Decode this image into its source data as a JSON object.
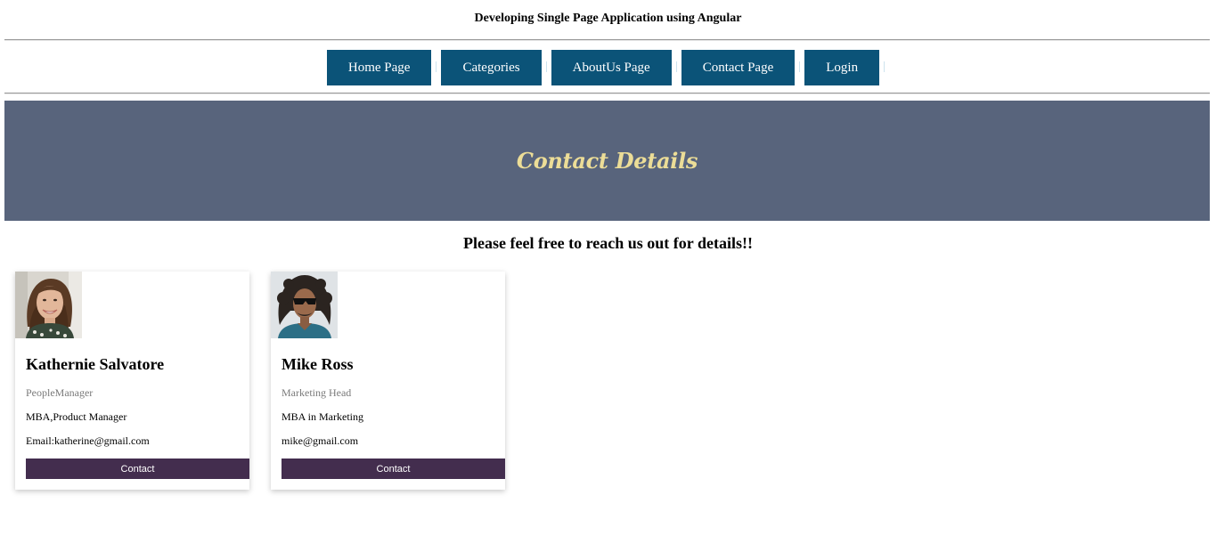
{
  "header": {
    "title": "Developing Single Page Application using Angular"
  },
  "nav": {
    "items": [
      {
        "label": "Home Page"
      },
      {
        "label": "Categories"
      },
      {
        "label": "AboutUs Page"
      },
      {
        "label": "Contact Page"
      },
      {
        "label": "Login"
      }
    ],
    "color": "#0b5378"
  },
  "banner": {
    "title": "Contact Details",
    "background": "#58647c",
    "text_color": "#ecdd97"
  },
  "subheading": "Please feel free to reach us out for details!!",
  "cards": [
    {
      "name": "Kathernie Salvatore",
      "role": "PeopleManager",
      "qualification": "MBA,Product Manager",
      "email": "Email:katherine@gmail.com",
      "button_label": "Contact"
    },
    {
      "name": "Mike Ross",
      "role": "Marketing Head",
      "qualification": "MBA in Marketing",
      "email": "mike@gmail.com",
      "button_label": "Contact"
    }
  ],
  "button_color": "#432d4e"
}
